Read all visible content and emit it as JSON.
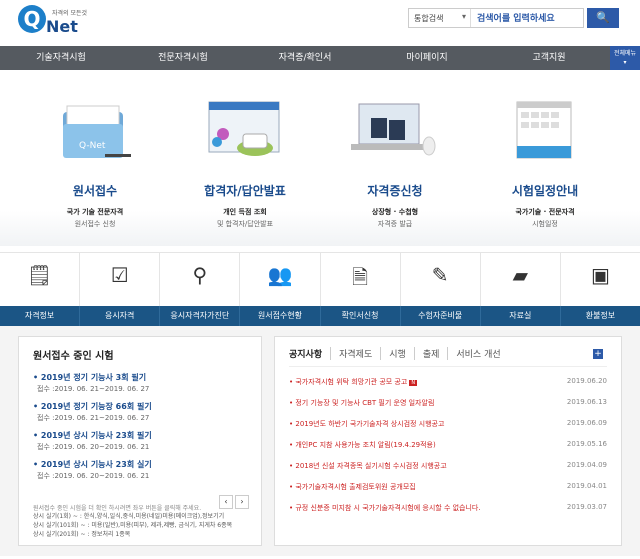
{
  "brand": {
    "name": "Net",
    "q": "Q",
    "sub": "자격의 모든것"
  },
  "search": {
    "category": "통합검색",
    "value": "검색어를 입력하세요",
    "btn": "🔍"
  },
  "gnb": {
    "items": [
      "기술자격시험",
      "전문자격시험",
      "자격증/확인서",
      "마이페이지",
      "고객지원"
    ],
    "all": "전체메뉴"
  },
  "visual": [
    {
      "title": "원서접수",
      "sub1": "국가 기술 전문자격",
      "sub2": "원서접수 신청"
    },
    {
      "title": "합격자/답안발표",
      "sub1": "개인 득점 조회",
      "sub2": "및 합격자/답안발표"
    },
    {
      "title": "자격증신청",
      "sub1": "상장형 · 수첩형",
      "sub2": "자격증 발급"
    },
    {
      "title": "시험일정안내",
      "sub1": "국가기술 · 전문자격",
      "sub2": "시험일정"
    }
  ],
  "quick": [
    {
      "label": "자격정보",
      "icon": "document-icon"
    },
    {
      "label": "응시자격",
      "icon": "checklist-icon"
    },
    {
      "label": "응시자격자가진단",
      "icon": "magnifier-icon"
    },
    {
      "label": "원서접수현황",
      "icon": "people-icon"
    },
    {
      "label": "확인서신청",
      "icon": "certificate-icon"
    },
    {
      "label": "수험자준비물",
      "icon": "pencil-icon"
    },
    {
      "label": "자료실",
      "icon": "folder-icon"
    },
    {
      "label": "환불정보",
      "icon": "money-icon"
    }
  ],
  "exams": {
    "title": "원서접수 중인 시험",
    "list": [
      {
        "t": "2019년 정기 기능사 3회 필기",
        "d": "접수 :2019. 06. 21~2019. 06. 27"
      },
      {
        "t": "2019년 정기 기능장 66회 필기",
        "d": "접수 :2019. 06. 21~2019. 06. 27"
      },
      {
        "t": "2019년 상시 기능사 23회 필기",
        "d": "접수 :2019. 06. 20~2019. 06. 21"
      },
      {
        "t": "2019년 상시 기능사 23회 실기",
        "d": "접수 :2019. 06. 20~2019. 06. 21"
      }
    ],
    "prev": "‹",
    "next": "›",
    "note": "원서접수 중인 시험을 더 확인 하시려면 좌우 버튼을 클릭해 주세요.",
    "lines": [
      "상시 실기(1회) ~ : 한식,양식,일식,중식,미용(네일)미용(메이크업),정보기기",
      "상시 실기(101회) ~ : 미용(일반),미용(피부), 제과,제빵, 금식기, 지게차 6종목",
      "상시 실기(201회) ~ : 정보처리 1종목"
    ]
  },
  "notice": {
    "tabs": [
      "공지사항",
      "자격제도",
      "시행",
      "출제",
      "서비스 개선"
    ],
    "plus": "+",
    "new": "N",
    "items": [
      {
        "t": "국가자격시험 위탁 희망기관 공모 공고",
        "d": "2019.06.20",
        "new": true
      },
      {
        "t": "정기 기능장 및 기능사 CBT 필기 운영 일자알림",
        "d": "2019.06.13"
      },
      {
        "t": "2019년도 하반기 국가기술자격 상시검정 시행공고",
        "d": "2019.06.09"
      },
      {
        "t": "개인PC 지참 사용가능 조치 알림(19.4.29적용)",
        "d": "2019.05.16"
      },
      {
        "t": "2018년 신설 자격종목 실기시험 수시검정 시행공고",
        "d": "2019.04.09"
      },
      {
        "t": "국가기술자격시험 출제검토위원 공개모집",
        "d": "2019.04.01"
      },
      {
        "t": "규정 신분증 미지참 시 국가기술자격시험에 응시할 수 없습니다.",
        "d": "2019.03.07"
      }
    ]
  }
}
